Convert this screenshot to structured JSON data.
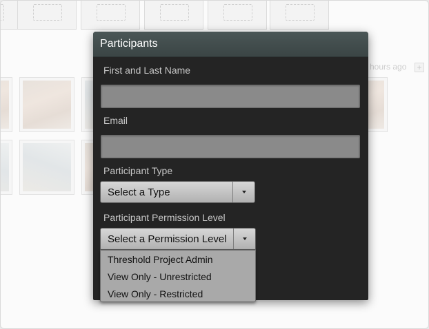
{
  "background": {
    "timeago_text": "hours ago"
  },
  "modal": {
    "title": "Participants",
    "name_label": "First and Last Name",
    "name_value": "",
    "email_label": "Email",
    "email_value": "",
    "type_label": "Participant Type",
    "type_selected": "Select a Type",
    "permission_label": "Participant Permission Level",
    "permission_selected": "Select a Permission Level",
    "permission_options": [
      "Threshold Project Admin",
      "View Only - Unrestricted",
      "View Only - Restricted"
    ]
  },
  "colors": {
    "header": "#3b4545",
    "modal_bg": "#242424",
    "field_bg": "#8a8a8a",
    "dropdown_bg": "#a9a9a9"
  }
}
